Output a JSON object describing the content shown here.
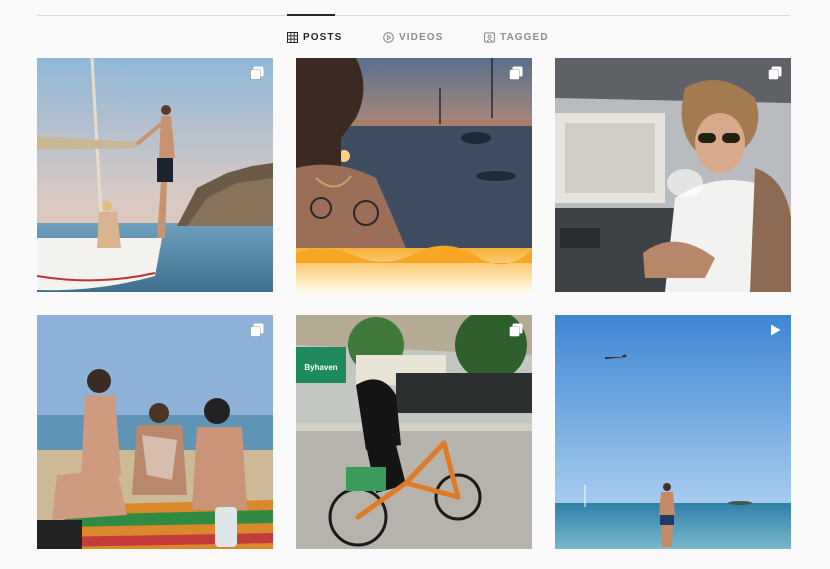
{
  "profile_tabs": {
    "posts": {
      "label": "POSTS",
      "icon": "grid-icon",
      "active": true
    },
    "videos": {
      "label": "VIDEOS",
      "icon": "play-circle-icon",
      "active": false
    },
    "tagged": {
      "label": "TAGGED",
      "icon": "tag-portrait-icon",
      "active": false
    }
  },
  "posts": [
    {
      "scene": "man on sailboat mast at sunset, woman sitting on deck",
      "type": "carousel",
      "badge_icon": "carousel-icon"
    },
    {
      "scene": "tattooed man close-up at sunset over sea with sailboats",
      "type": "carousel",
      "badge_icon": "carousel-icon"
    },
    {
      "scene": "man in sunglasses vaping in car",
      "type": "carousel",
      "badge_icon": "carousel-icon"
    },
    {
      "scene": "group of people sitting on beach towels",
      "type": "carousel",
      "badge_icon": "carousel-icon"
    },
    {
      "scene": "person riding orange bike on city street",
      "type": "carousel",
      "badge_icon": "carousel-icon",
      "sign_text": "Byhaven"
    },
    {
      "scene": "man standing in sea, plane in blue sky",
      "type": "video",
      "badge_icon": "play-icon"
    }
  ],
  "colors": {
    "background": "#fafafa",
    "active_tab": "#262626",
    "inactive_tab": "#8e8e8e",
    "divider": "#dbdbdb"
  }
}
